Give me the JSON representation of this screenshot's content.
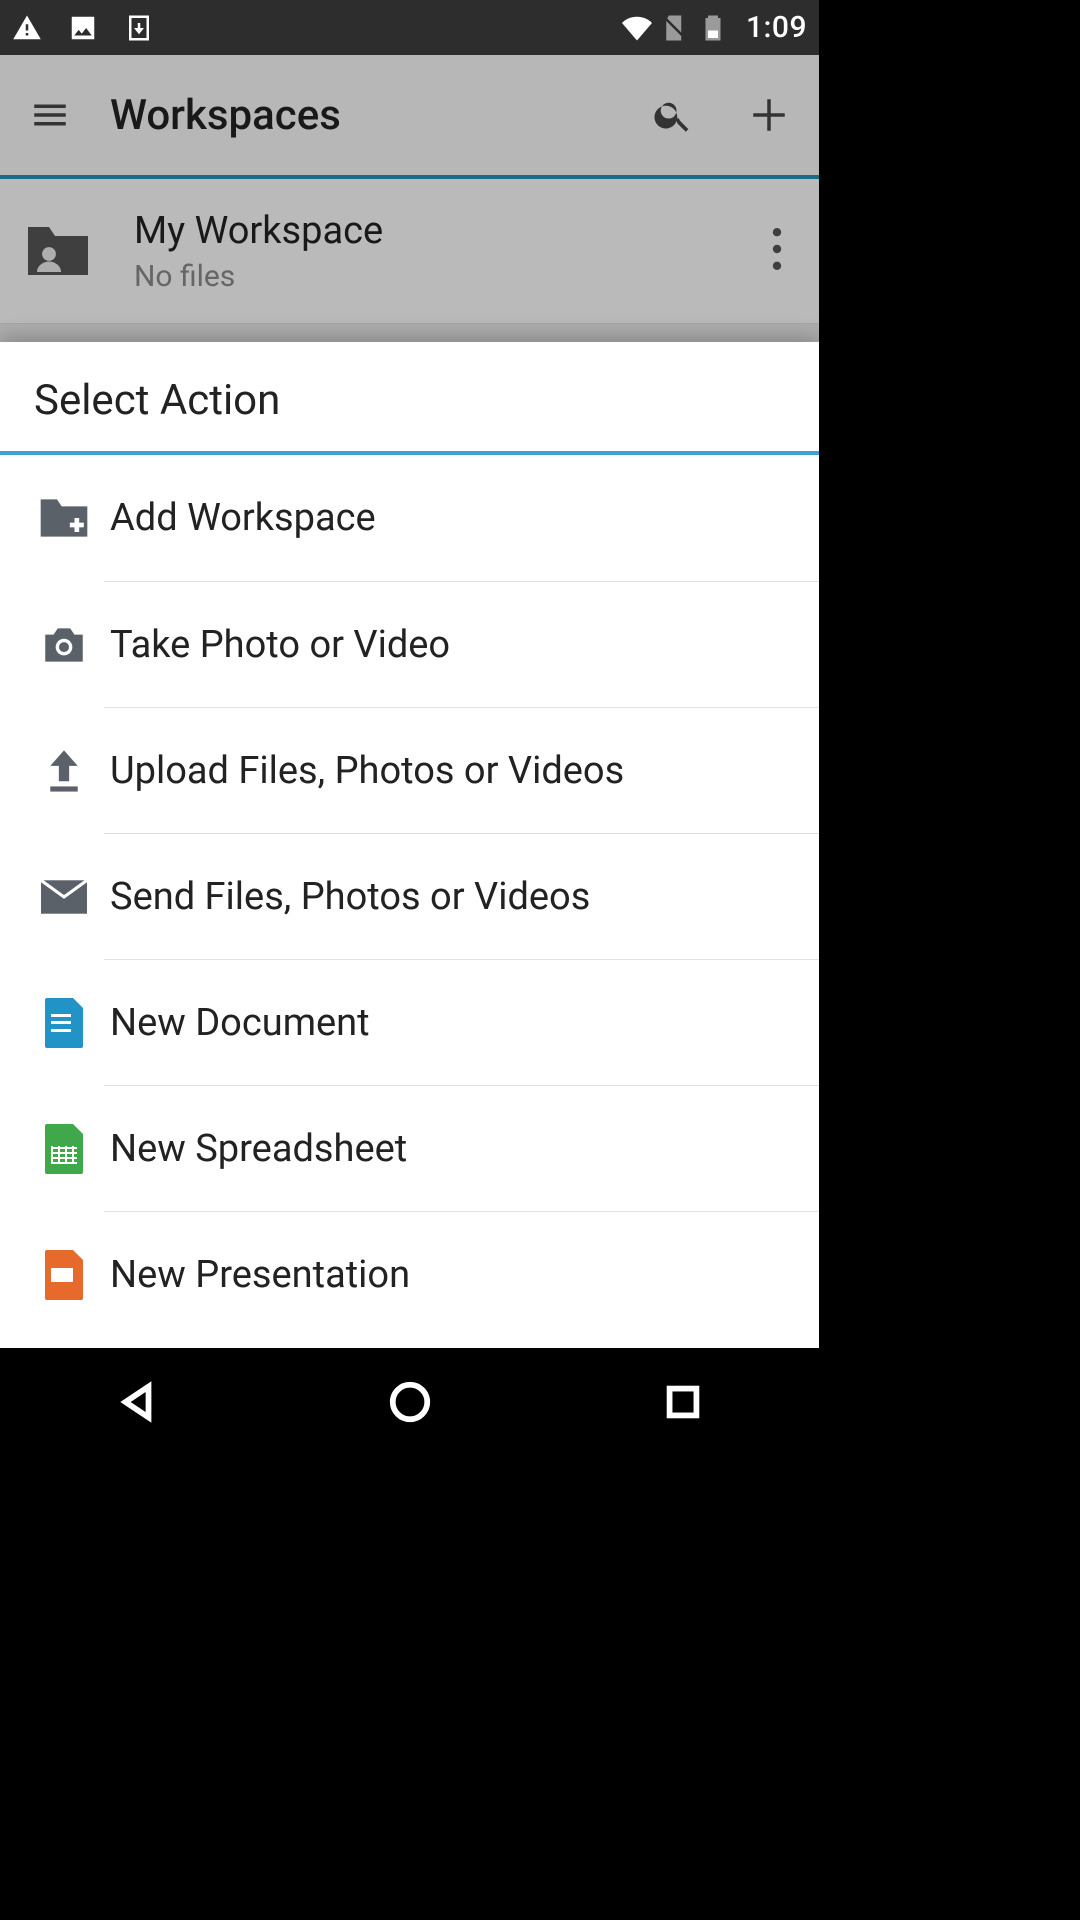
{
  "statusbar": {
    "time": "1:09",
    "icons_left": [
      "warning-icon",
      "image-icon",
      "download-box-icon"
    ],
    "icons_right": [
      "wifi-icon",
      "no-sim-icon",
      "battery-icon"
    ]
  },
  "appbar": {
    "title": "Workspaces"
  },
  "workspace": {
    "title": "My Workspace",
    "subtitle": "No files"
  },
  "sheet": {
    "title": "Select Action",
    "actions": [
      {
        "id": "add-workspace",
        "label": "Add Workspace",
        "icon": "folder-plus-icon",
        "color": "#5a6168"
      },
      {
        "id": "take-photo",
        "label": "Take Photo or Video",
        "icon": "camera-icon",
        "color": "#5a6168"
      },
      {
        "id": "upload",
        "label": "Upload Files, Photos or Videos",
        "icon": "upload-icon",
        "color": "#5a6168"
      },
      {
        "id": "send",
        "label": "Send Files, Photos or Videos",
        "icon": "mail-icon",
        "color": "#5a6168"
      },
      {
        "id": "new-document",
        "label": "New Document",
        "icon": "doc-blue",
        "color": "#2193c6"
      },
      {
        "id": "new-spreadsheet",
        "label": "New Spreadsheet",
        "icon": "doc-green",
        "color": "#3fa84a"
      },
      {
        "id": "new-presentation",
        "label": "New Presentation",
        "icon": "doc-orange",
        "color": "#e66a2b"
      }
    ]
  }
}
